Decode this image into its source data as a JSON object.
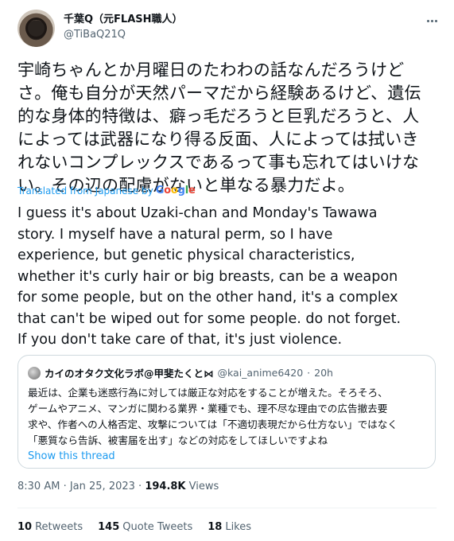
{
  "author": {
    "display_name": "千葉Q（元FLASH職人）",
    "handle": "@TiBaQ21Q"
  },
  "tweet": {
    "original_text": "宇崎ちゃんとか月曜日のたわわの話なんだろうけど\nさ。俺も自分が天然パーマだから経験あるけど、遺伝\n的な身体的特徴は、癖っ毛だろうと巨乳だろうと、人\nによっては武器になり得る反面、人によっては拭いき\nれないコンプレックスであるって事も忘れてはいけな\nい。その辺の配慮がないと単なる暴力だよ。",
    "translated_label": "Translated from Japanese by",
    "google_letters": [
      "G",
      "o",
      "o",
      "g",
      "l",
      "e"
    ],
    "translation": "I guess it's about Uzaki-chan and Monday's Tawawa\nstory. I myself have a natural perm, so I have\nexperience, but genetic physical characteristics,\nwhether it's curly hair or big breasts, can be a weapon\nfor some people, but on the other hand, it's a complex\nthat can't be wiped out for some people. do not forget.\nIf you don't take care of that, it's just violence."
  },
  "quoted_tweet": {
    "display_name": "カイのオタク文化ラボ@甲斐たくと⋈",
    "handle": "@kai_anime6420",
    "separator": "·",
    "time": "20h",
    "text": "最近は、企業も迷惑行為に対しては厳正な対応をすることが増えた。そろそろ、\nゲームやアニメ、マンガに関わる業界・業種でも、理不尽な理由での広告撤去要\n求や、作者への人格否定、攻撃については「不適切表現だから仕方ない」ではなく\n「悪質なら告訴、被害届を出す」などの対応をしてほしいですよね",
    "show_thread": "Show this thread"
  },
  "meta": {
    "time": "8:30 AM",
    "separator": " · ",
    "date": "Jan 25, 2023",
    "views_count": "194.8K",
    "views_label": " Views"
  },
  "stats": {
    "retweets_count": "10",
    "retweets_label": "Retweets",
    "quotes_count": "145",
    "quotes_label": "Quote Tweets",
    "likes_count": "18",
    "likes_label": "Likes"
  },
  "colors": {
    "link": "#1d9bf0",
    "secondary_text": "#536471",
    "border": "#cfd9de"
  },
  "icons": [
    "more-options-icon",
    "avatar",
    "google-logo"
  ]
}
